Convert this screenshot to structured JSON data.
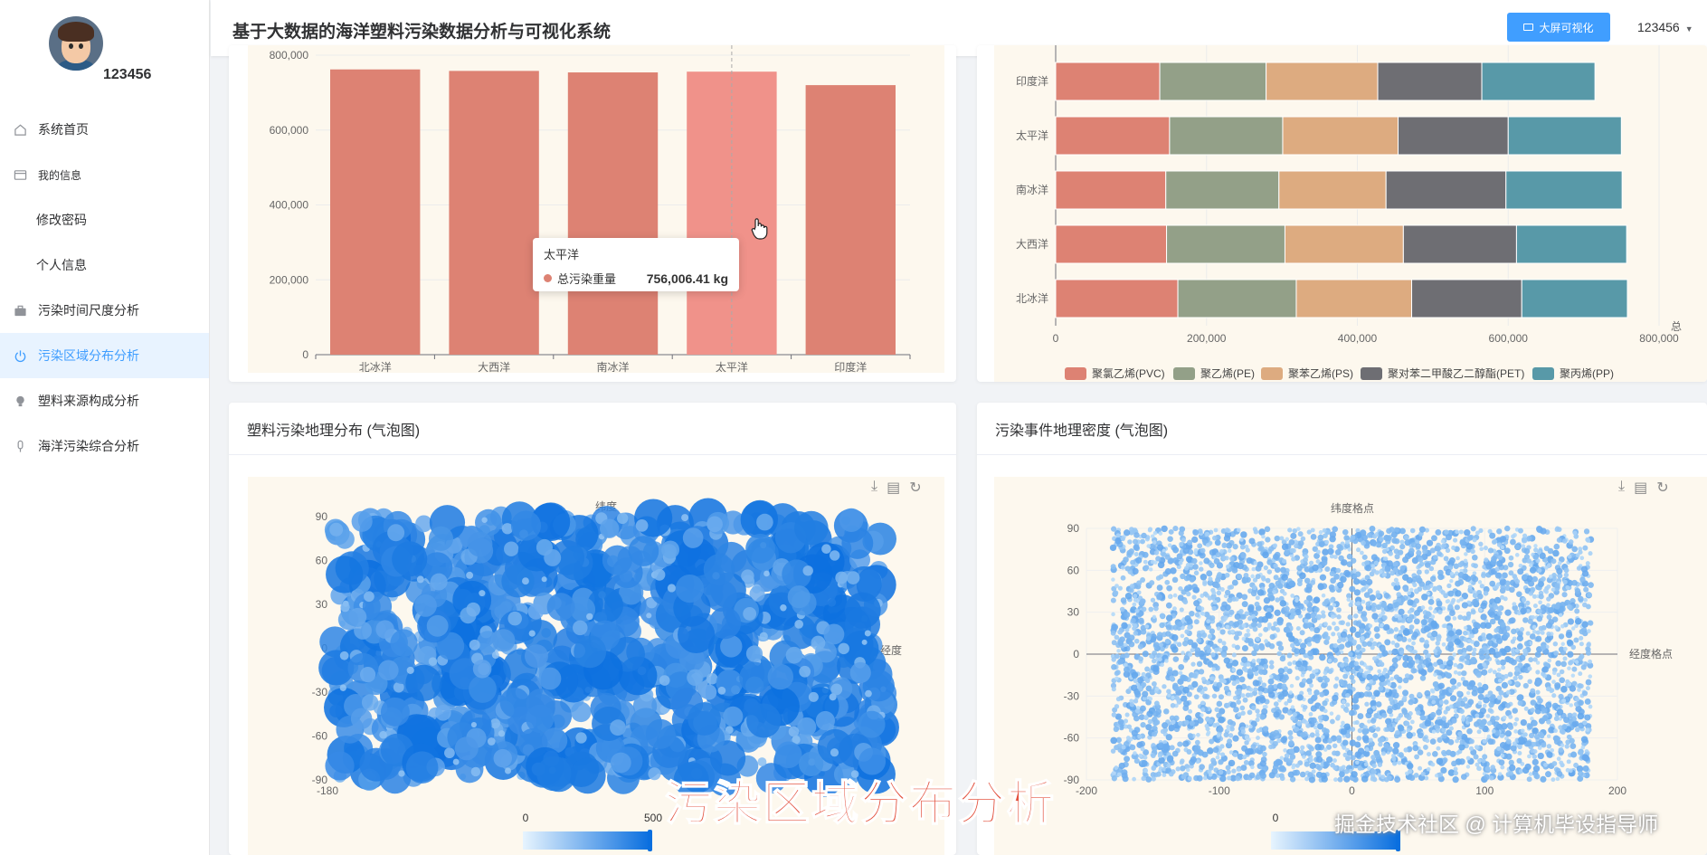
{
  "app": {
    "title": "基于大数据的海洋塑料污染数据分析与可视化系统",
    "bigscreen_label": "大屏可视化",
    "username": "123456"
  },
  "sidebar": {
    "username": "123456",
    "items": [
      {
        "label": "系统首页",
        "icon": "home-icon"
      },
      {
        "label": "我的信息",
        "icon": "id-card-icon"
      },
      {
        "label": "修改密码",
        "icon": ""
      },
      {
        "label": "个人信息",
        "icon": ""
      },
      {
        "label": "污染时间尺度分析",
        "icon": "briefcase-icon"
      },
      {
        "label": "污染区域分布分析",
        "icon": "power-icon",
        "active": true
      },
      {
        "label": "塑料来源构成分析",
        "icon": "bulb-icon"
      },
      {
        "label": "海洋污染综合分析",
        "icon": "mic-icon"
      }
    ]
  },
  "cards": {
    "geo_title": "塑料污染地理分布 (气泡图)",
    "density_title": "污染事件地理密度 (气泡图)"
  },
  "tooltip": {
    "title": "太平洋",
    "series": "总污染重量",
    "value": "756,006.41 kg"
  },
  "overlay": {
    "title": "污染区域分布分析",
    "watermark": "掘金技术社区 @ 计算机毕设指导师"
  },
  "colors": {
    "accent": "#409eff",
    "bar": "#dd8273",
    "bar_highlight": "#f0928a",
    "pvc": "#dd8273",
    "pe": "#93a088",
    "ps": "#ddab80",
    "pet": "#6e6e73",
    "pp": "#5899a8",
    "bubble_dark": "#0a6fdf",
    "bubble_light": "#c6e4fb"
  },
  "chart_data": [
    {
      "type": "bar",
      "categories": [
        "北冰洋",
        "大西洋",
        "南冰洋",
        "太平洋",
        "印度洋"
      ],
      "series": [
        {
          "name": "总污染重量",
          "values": [
            762000,
            758000,
            754000,
            756006.41,
            720000
          ]
        }
      ],
      "yticks": [
        "0",
        "200,000",
        "400,000",
        "600,000",
        "800,000"
      ],
      "ylim": [
        0,
        800000
      ],
      "highlight_index": 3
    },
    {
      "type": "bar",
      "orientation": "horizontal-stacked",
      "categories": [
        "北冰洋",
        "大西洋",
        "南冰洋",
        "太平洋",
        "印度洋"
      ],
      "series": [
        {
          "name": "聚氯乙烯(PVC)",
          "values": [
            162000,
            147000,
            146000,
            151000,
            138000
          ]
        },
        {
          "name": "聚乙烯(PE)",
          "values": [
            157000,
            157000,
            150000,
            150000,
            141000
          ]
        },
        {
          "name": "聚苯乙烯(PS)",
          "values": [
            153000,
            157000,
            142000,
            153000,
            148000
          ]
        },
        {
          "name": "聚对苯二甲酸乙二醇酯(PET)",
          "values": [
            146000,
            150000,
            159000,
            146000,
            138000
          ]
        },
        {
          "name": "聚丙烯(PP)",
          "values": [
            140000,
            146000,
            154000,
            150000,
            150000
          ]
        }
      ],
      "xticks": [
        "0",
        "200,000",
        "400,000",
        "600,000",
        "800,000"
      ],
      "xlim": [
        0,
        800000
      ],
      "xlabel": "总",
      "legend": "bottom"
    },
    {
      "type": "scatter",
      "subtype": "bubble",
      "xlabel": "经度",
      "ylabel": "纬度",
      "xlim": [
        -180,
        180
      ],
      "ylim": [
        -90,
        90
      ],
      "yticks": [
        "90",
        "60",
        "30",
        "0",
        "-30",
        "-60",
        "-90"
      ],
      "xticks": [
        "-180"
      ],
      "visualmap": {
        "min": "0",
        "max": "500"
      },
      "point_count": 1100,
      "size_range": [
        3,
        22
      ]
    },
    {
      "type": "scatter",
      "subtype": "density",
      "xlabel": "经度格点",
      "ylabel": "纬度格点",
      "xlim": [
        -200,
        200
      ],
      "ylim": [
        -90,
        90
      ],
      "xticks": [
        "-200",
        "-100",
        "0",
        "100",
        "200"
      ],
      "yticks": [
        "90",
        "60",
        "30",
        "0",
        "-30",
        "-60",
        "-90"
      ],
      "visualmap": {
        "min": "0"
      },
      "point_count": 4200,
      "data_range": [
        -180,
        180
      ]
    }
  ]
}
